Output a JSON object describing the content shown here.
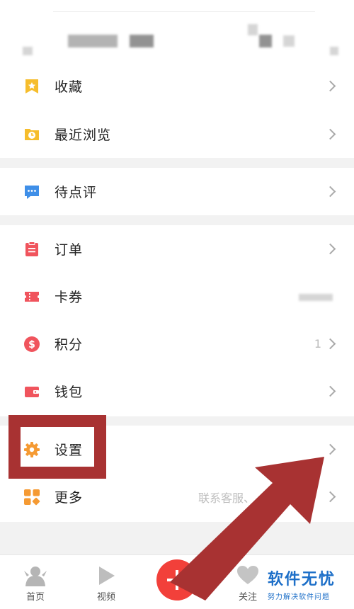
{
  "menu": {
    "group1": [
      {
        "label": "收藏",
        "icon": "star-bookmark-icon",
        "color": "#f6bd2c"
      },
      {
        "label": "最近浏览",
        "icon": "recent-clock-icon",
        "color": "#f6bd2c"
      }
    ],
    "group2": [
      {
        "label": "待点评",
        "icon": "comment-bubble-icon",
        "color": "#3f8fe8"
      }
    ],
    "group3": [
      {
        "label": "订单",
        "icon": "order-list-icon",
        "color": "#f0545d"
      },
      {
        "label": "卡券",
        "icon": "coupon-ticket-icon",
        "color": "#f0545d"
      },
      {
        "label": "积分",
        "icon": "points-coin-icon",
        "color": "#f0545d",
        "value": "1"
      },
      {
        "label": "钱包",
        "icon": "wallet-icon",
        "color": "#f0545d"
      }
    ],
    "group4": [
      {
        "label": "设置",
        "icon": "settings-gear-icon",
        "color": "#f59a33"
      },
      {
        "label": "更多",
        "icon": "more-grid-icon",
        "color": "#f59a33",
        "value": "联系客服、"
      }
    ]
  },
  "tabbar": {
    "home_label": "首页",
    "video_label": "视频",
    "follow_label": "关注"
  },
  "watermark": {
    "title": "软件无忧",
    "subtitle": "努力解决软件问题"
  },
  "colors": {
    "highlight": "#a83232",
    "fab": "#f2403a",
    "watermark": "#1d6fc8"
  }
}
